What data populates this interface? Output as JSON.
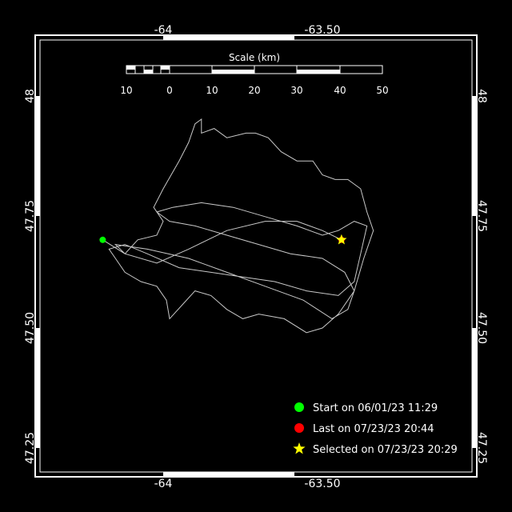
{
  "map": {
    "x_ticks": [
      "-64",
      "-63.50"
    ],
    "y_ticks": [
      "48",
      "47.75",
      "47.50",
      "47.25"
    ],
    "scale": {
      "title": "Scale (km)",
      "labels": [
        "10",
        "0",
        "10",
        "20",
        "30",
        "40",
        "50"
      ]
    },
    "colors": {
      "background": "#000000",
      "frame": "#ffffff",
      "track": "#c8c8c8",
      "start": "#00ff00",
      "last": "#ff0000",
      "selected": "#ffff00"
    },
    "legend": [
      {
        "marker": "green-dot",
        "label": "Start on 06/01/23 11:29"
      },
      {
        "marker": "red-dot",
        "label": "Last on 07/23/23 20:44"
      },
      {
        "marker": "yellow-star",
        "label": "Selected on 07/23/23 20:29"
      }
    ],
    "positions": {
      "start": {
        "lon": -64.19,
        "lat": 47.69
      },
      "last": {
        "lon": -63.44,
        "lat": 47.69
      },
      "selected": {
        "lon": -63.44,
        "lat": 47.69
      }
    },
    "track": [
      [
        -64.19,
        47.69
      ],
      [
        -64.12,
        47.66
      ],
      [
        -64.08,
        47.69
      ],
      [
        -64.02,
        47.7
      ],
      [
        -64.0,
        47.73
      ],
      [
        -64.03,
        47.76
      ],
      [
        -64.0,
        47.8
      ],
      [
        -63.95,
        47.86
      ],
      [
        -63.92,
        47.9
      ],
      [
        -63.9,
        47.94
      ],
      [
        -63.88,
        47.95
      ],
      [
        -63.88,
        47.92
      ],
      [
        -63.84,
        47.93
      ],
      [
        -63.8,
        47.91
      ],
      [
        -63.74,
        47.92
      ],
      [
        -63.71,
        47.92
      ],
      [
        -63.67,
        47.91
      ],
      [
        -63.63,
        47.88
      ],
      [
        -63.58,
        47.86
      ],
      [
        -63.53,
        47.86
      ],
      [
        -63.5,
        47.83
      ],
      [
        -63.46,
        47.82
      ],
      [
        -63.42,
        47.82
      ],
      [
        -63.38,
        47.8
      ],
      [
        -63.36,
        47.75
      ],
      [
        -63.34,
        47.71
      ],
      [
        -63.37,
        47.65
      ],
      [
        -63.4,
        47.58
      ],
      [
        -63.45,
        47.53
      ],
      [
        -63.5,
        47.5
      ],
      [
        -63.55,
        47.49
      ],
      [
        -63.62,
        47.52
      ],
      [
        -63.7,
        47.53
      ],
      [
        -63.75,
        47.52
      ],
      [
        -63.8,
        47.54
      ],
      [
        -63.85,
        47.57
      ],
      [
        -63.9,
        47.58
      ],
      [
        -63.94,
        47.55
      ],
      [
        -63.98,
        47.52
      ],
      [
        -63.99,
        47.56
      ],
      [
        -64.02,
        47.59
      ],
      [
        -64.07,
        47.6
      ],
      [
        -64.12,
        47.62
      ],
      [
        -64.15,
        47.65
      ],
      [
        -64.17,
        47.67
      ],
      [
        -64.12,
        47.68
      ],
      [
        -64.05,
        47.66
      ],
      [
        -63.95,
        47.63
      ],
      [
        -63.85,
        47.62
      ],
      [
        -63.75,
        47.61
      ],
      [
        -63.65,
        47.6
      ],
      [
        -63.55,
        47.58
      ],
      [
        -63.45,
        47.57
      ],
      [
        -63.4,
        47.6
      ],
      [
        -63.38,
        47.66
      ],
      [
        -63.36,
        47.72
      ],
      [
        -63.4,
        47.73
      ],
      [
        -63.45,
        47.71
      ],
      [
        -63.5,
        47.7
      ],
      [
        -63.58,
        47.72
      ],
      [
        -63.68,
        47.74
      ],
      [
        -63.78,
        47.76
      ],
      [
        -63.88,
        47.77
      ],
      [
        -63.97,
        47.76
      ],
      [
        -64.02,
        47.75
      ],
      [
        -63.98,
        47.73
      ],
      [
        -63.9,
        47.72
      ],
      [
        -63.8,
        47.7
      ],
      [
        -63.7,
        47.68
      ],
      [
        -63.6,
        47.66
      ],
      [
        -63.5,
        47.65
      ],
      [
        -63.43,
        47.62
      ],
      [
        -63.4,
        47.58
      ],
      [
        -63.42,
        47.54
      ],
      [
        -63.47,
        47.52
      ],
      [
        -63.56,
        47.56
      ],
      [
        -63.68,
        47.59
      ],
      [
        -63.8,
        47.62
      ],
      [
        -63.92,
        47.65
      ],
      [
        -64.05,
        47.67
      ],
      [
        -64.15,
        47.68
      ],
      [
        -64.12,
        47.66
      ],
      [
        -64.02,
        47.64
      ],
      [
        -63.92,
        47.67
      ],
      [
        -63.8,
        47.71
      ],
      [
        -63.68,
        47.73
      ],
      [
        -63.58,
        47.73
      ],
      [
        -63.5,
        47.71
      ],
      [
        -63.44,
        47.69
      ]
    ]
  }
}
